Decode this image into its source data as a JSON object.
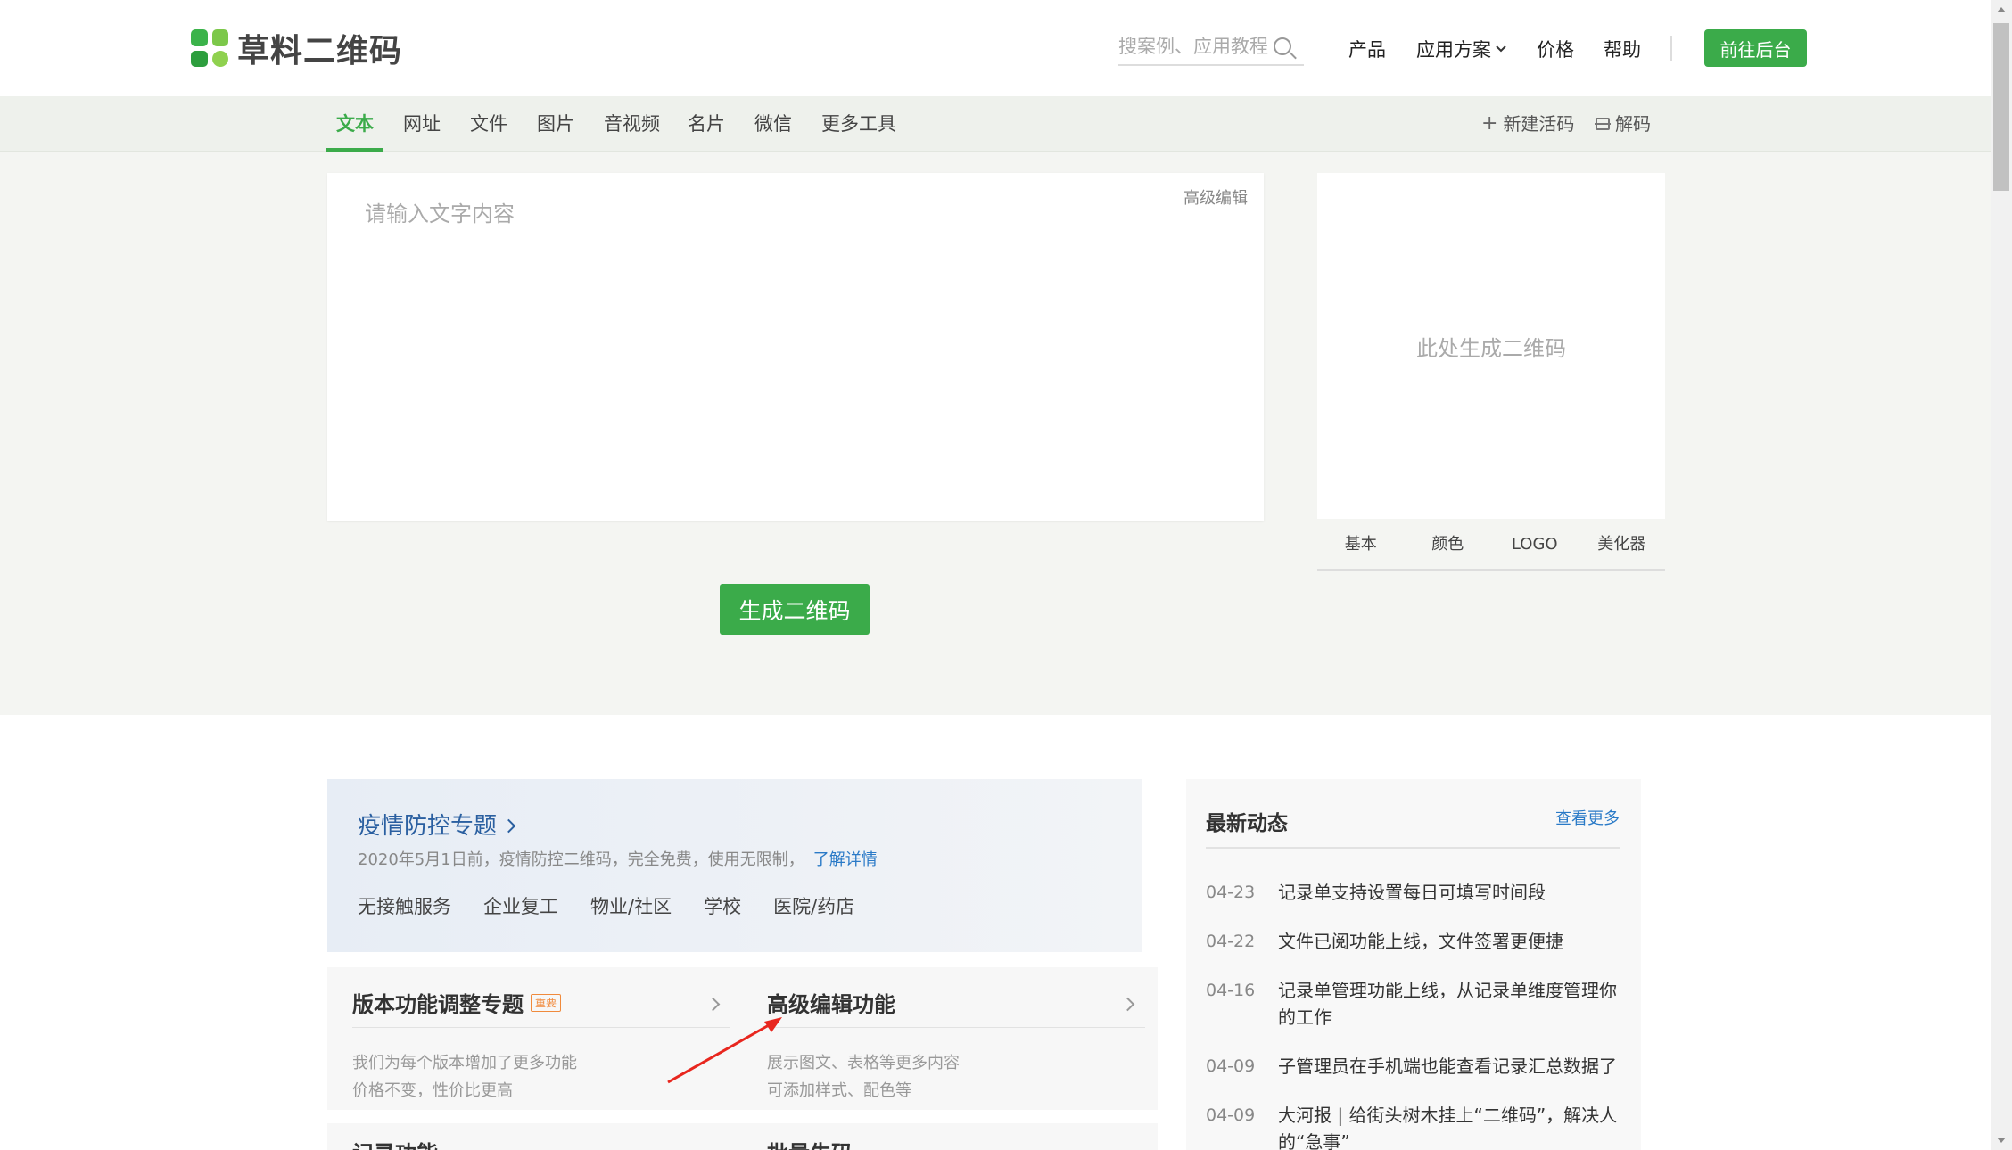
{
  "header": {
    "logo_text": "草料二维码",
    "search_placeholder": "搜案例、应用教程",
    "nav": [
      "产品",
      "应用方案",
      "价格",
      "帮助"
    ],
    "admin_button": "前往后台"
  },
  "tabs": {
    "items": [
      "文本",
      "网址",
      "文件",
      "图片",
      "音视频",
      "名片",
      "微信",
      "更多工具"
    ],
    "active": "文本",
    "new_live_code": "新建活码",
    "decode": "解码"
  },
  "editor": {
    "placeholder": "请输入文字内容",
    "advanced_edit": "高级编辑",
    "generate_button": "生成二维码"
  },
  "qr_panel": {
    "placeholder": "此处生成二维码",
    "tabs": [
      "基本",
      "颜色",
      "LOGO",
      "美化器"
    ]
  },
  "epidemic": {
    "title": "疫情防控专题",
    "desc": "2020年5月1日前，疫情防控二维码，完全免费，使用无限制，",
    "link": "了解详情",
    "tags": [
      "无接触服务",
      "企业复工",
      "物业/社区",
      "学校",
      "医院/药店"
    ]
  },
  "cards": [
    {
      "title": "版本功能调整专题",
      "badge": "重要",
      "lines": [
        "我们为每个版本增加了更多功能",
        "价格不变，性价比更高"
      ]
    },
    {
      "title": "高级编辑功能",
      "lines": [
        "展示图文、表格等更多内容",
        "可添加样式、配色等"
      ]
    }
  ],
  "stub_cards": [
    "记录功能",
    "批量生码"
  ],
  "news": {
    "title": "最新动态",
    "more": "查看更多",
    "items": [
      {
        "date": "04-23",
        "text": "记录单支持设置每日可填写时间段"
      },
      {
        "date": "04-22",
        "text": "文件已阅功能上线，文件签署更便捷"
      },
      {
        "date": "04-16",
        "text": "记录单管理功能上线，从记录单维度管理你的工作"
      },
      {
        "date": "04-09",
        "text": "子管理员在手机端也能查看记录汇总数据了"
      },
      {
        "date": "04-09",
        "text": "大河报 | 给街头树木挂上“二维码”，解决人的“急事”"
      }
    ]
  },
  "colors": {
    "brand_green": "#3bab4a",
    "link_blue": "#2a7ac7",
    "epidemic_blue": "#2a5fa0",
    "annotation_red": "#e8261e"
  }
}
